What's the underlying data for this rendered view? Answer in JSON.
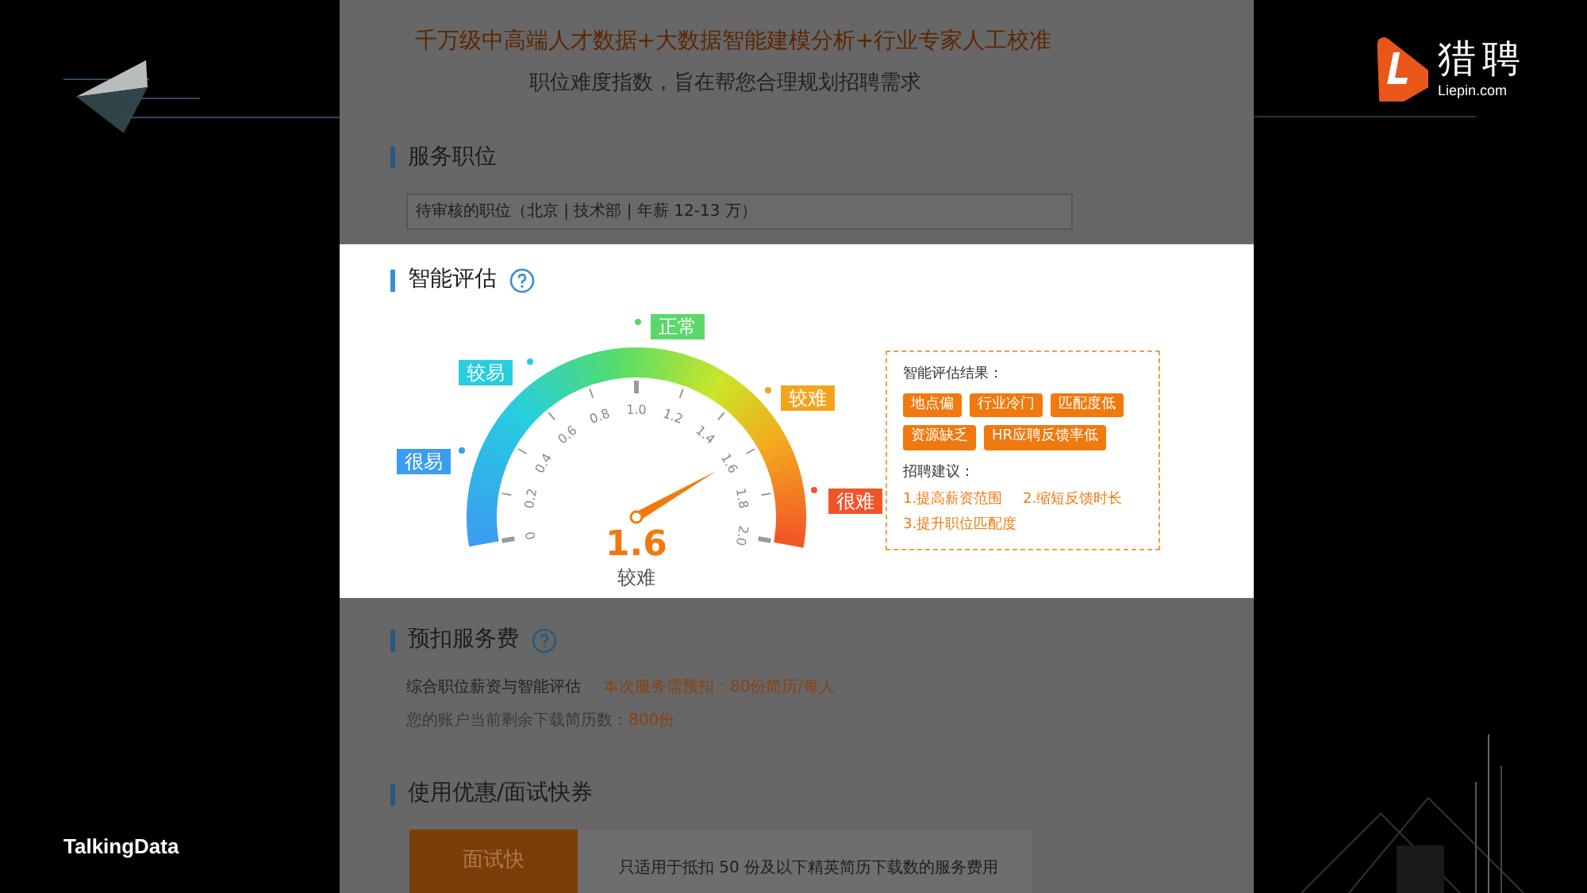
{
  "slide": {
    "brand": "TalkingData",
    "logo": {
      "name": "猎聘",
      "domain": "Liepin.com"
    }
  },
  "header": {
    "tagline": "千万级中高端人才数据+大数据智能建模分析+行业专家人工校准",
    "subtitle": "职位难度指数，旨在帮您合理规划招聘需求"
  },
  "position_section": {
    "title": "服务职位",
    "field_value": "待审核的职位（北京 | 技术部 | 年薪 12-13 万）"
  },
  "evaluation": {
    "title": "智能评估",
    "gauge": {
      "ticks": [
        "0",
        "0.2",
        "0.4",
        "0.6",
        "0.8",
        "1.0",
        "1.2",
        "1.4",
        "1.6",
        "1.8",
        "2.0"
      ],
      "value": "1.6",
      "rating": "较难",
      "zones": [
        {
          "label": "很易",
          "color": "#3b9df0"
        },
        {
          "label": "较易",
          "color": "#27cde0"
        },
        {
          "label": "正常",
          "color": "#5cd86a"
        },
        {
          "label": "较难",
          "color": "#f2a51c"
        },
        {
          "label": "很难",
          "color": "#f2542a"
        }
      ]
    },
    "result": {
      "title": "智能评估结果：",
      "tags": [
        "地点偏",
        "行业冷门",
        "匹配度低",
        "资源缺乏",
        "HR应聘反馈率低"
      ],
      "advice_title": "招聘建议：",
      "advice": [
        "1.提高薪资范围",
        "2.缩短反馈时长",
        "3.提升职位匹配度"
      ]
    }
  },
  "fee_section": {
    "title": "预扣服务费",
    "line1_label": "综合职位薪资与智能评估",
    "line1_value": "本次服务需预扣：80份简历/每人",
    "line2_label": "您的账户当前剩余下载简历数：",
    "line2_value": "800份"
  },
  "coupon_section": {
    "title": "使用优惠/面试快券",
    "coupon_name": "面试快",
    "coupon_note": "只适用于抵扣 50 份及以下精英简历下载数的服务费用"
  }
}
